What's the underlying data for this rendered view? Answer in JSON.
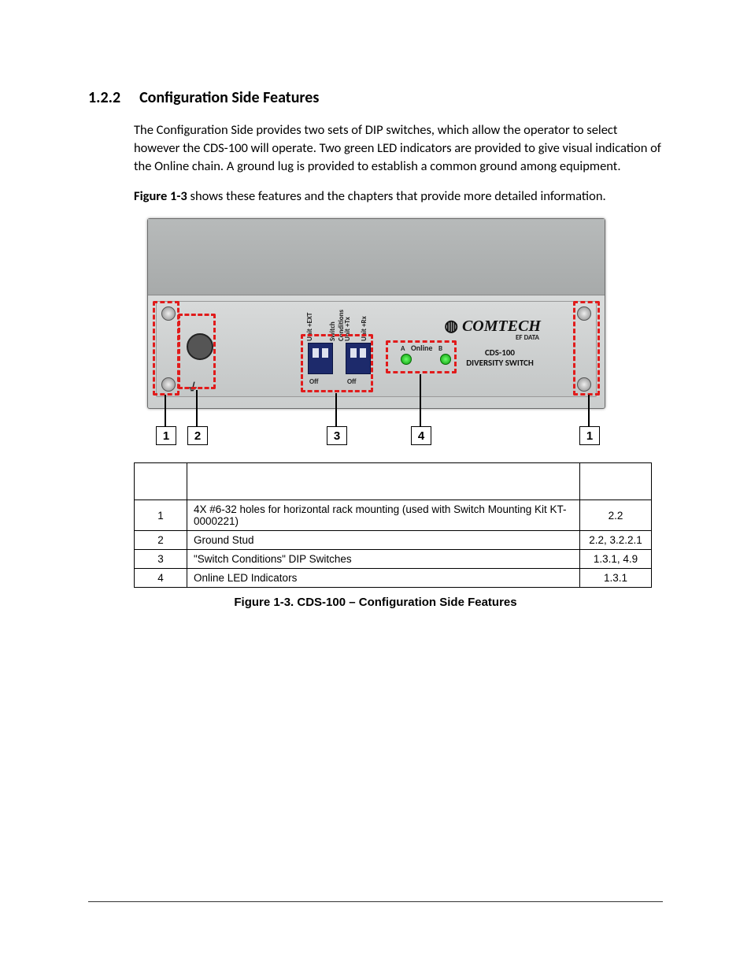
{
  "heading": {
    "number": "1.2.2",
    "title": "Configuration Side Features"
  },
  "para1": "The Configuration Side provides two sets of DIP switches, which allow the operator to select however the CDS-100 will operate. Two green LED indicators are provided to give visual indication of the Online chain. A ground lug is provided to establish a common ground among equipment.",
  "figref_bold": "Figure 1-3",
  "figref_rest": " shows these features and the chapters that provide more detailed information.",
  "device": {
    "brand": "COMTECH",
    "brand_sub": "EF DATA",
    "model_line1": "CDS-100",
    "model_line2": "DIVERSITY SWITCH",
    "online_label": "Online",
    "led_a": "A",
    "led_b": "B",
    "dip_group_label": "Switch Conditions",
    "dip_col_ext": "Unit +EXT",
    "dip_col_tx": "Unit +Tx",
    "dip_col_rx": "Unit +Rx",
    "dip_off_left": "Off",
    "dip_off_right": "Off"
  },
  "callouts": {
    "c1": "1",
    "c2": "2",
    "c3": "3",
    "c4": "4",
    "c1r": "1"
  },
  "table": {
    "rows": [
      {
        "idx": "1",
        "feature": "4X #6-32 holes for horizontal rack mounting (used with Switch Mounting Kit KT-0000221)",
        "ref": "2.2"
      },
      {
        "idx": "2",
        "feature": "Ground Stud",
        "ref": "2.2, 3.2.2.1"
      },
      {
        "idx": "3",
        "feature": "\"Switch Conditions\" DIP Switches",
        "ref": "1.3.1, 4.9"
      },
      {
        "idx": "4",
        "feature": "Online LED Indicators",
        "ref": "1.3.1"
      }
    ]
  },
  "caption": "Figure 1-3. CDS-100 – Configuration Side Features"
}
